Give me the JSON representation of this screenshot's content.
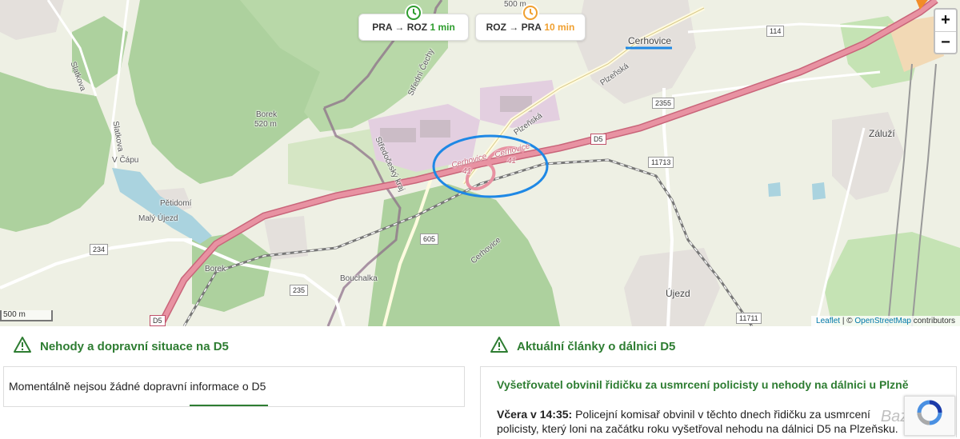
{
  "map": {
    "route_buttons": [
      {
        "label": "PRA → ROZ",
        "time": "1 min",
        "time_color": "#2e9d2e"
      },
      {
        "label": "ROZ → PRA",
        "time": "10 min",
        "time_color": "#f0a030"
      }
    ],
    "zoom_in": "+",
    "zoom_out": "−",
    "scale_label": "500 m",
    "attribution": {
      "leaflet": "Leaflet",
      "sep": " | © ",
      "osm": "OpenStreetMap",
      "suffix": " contributors"
    },
    "labels": {
      "cerhovice": "Cerhovice",
      "zaluzi": "Záluží",
      "ujezd": "Újezd",
      "petidomi": "Pětidomí",
      "maly_ujezd": "Malý Újezd",
      "v_capu": "V Čápu",
      "borek_hill": "Borek",
      "borek_hill_height": "520 m",
      "borek": "Borek",
      "bouchalka": "Bouchalka",
      "plzenska1": "Plzeňská",
      "plzenska2": "Plzeňská",
      "stredocesky": "Středočeský kraj",
      "stredni_cechy": "Střední Čechy",
      "slatkova": "Slatkova",
      "slatkova2": "Slatkova",
      "cerhovice_wood": "Cerhovice",
      "exit_a": "Cerhovice",
      "exit_a_num": "41",
      "exit_b": "Cerhovice",
      "exit_b_num": "41",
      "top_500": "500 m"
    },
    "shields": {
      "r114": "114",
      "r2355": "2355",
      "r11713": "11713",
      "r605": "605",
      "r234": "234",
      "r235": "235",
      "r11711": "11711",
      "d5a": "D5",
      "d5b": "D5"
    },
    "colors": {
      "motorway": "#e892a2",
      "forest": "#add19e",
      "highlight": "#1e88e5"
    }
  },
  "left_section": {
    "title": "Nehody a dopravní situace na D5",
    "message": "Momentálně nejsou žádné dopravní informace o D5"
  },
  "right_section": {
    "title": "Aktuální články o dálnici D5",
    "article_title": "Vyšetřovatel obvinil řidičku za usmrcení policisty u nehody na dálnici u Plzně",
    "article_time": "Včera v 14:35:",
    "article_text": "Policejní komisař obvinil v těchto dnech řidičku za usmrcení policisty, který loni na začátku roku vyšetřoval nehodu na dálnici D5 na Plzeňsku."
  },
  "watermark": "Bazoš.cz"
}
